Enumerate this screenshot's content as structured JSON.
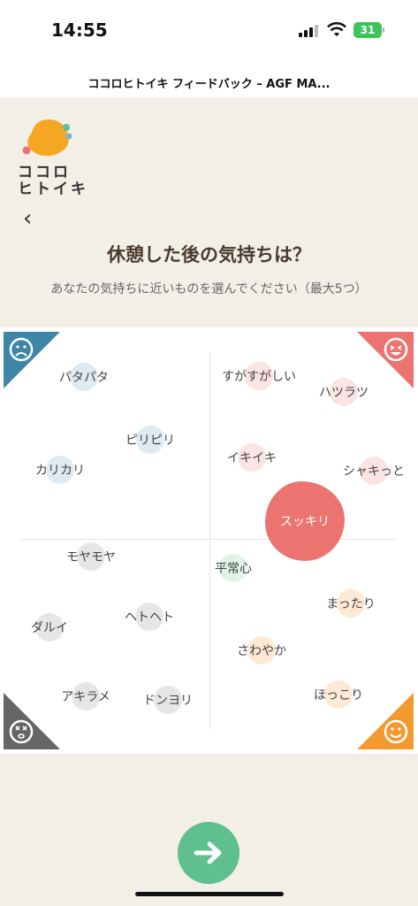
{
  "status_bar": {
    "time": "14:55",
    "battery": "31"
  },
  "page": {
    "title": "ココロヒトイキ フィードバック – AGF MA..."
  },
  "logo": {
    "line1": "ココロ",
    "line2": "ヒトイキ"
  },
  "nav": {
    "back": "‹"
  },
  "question": "休憩した後の気持ちは？",
  "subtitle": "あなたの気持ちに近いものを選んでください（最大5つ）",
  "colors": {
    "blue": "#3e86a8",
    "red": "#ec7470",
    "gray": "#666666",
    "orange": "#f39a2e",
    "green": "#5fbf8e"
  },
  "moods": {
    "patapata": "パタパタ",
    "piripiri": "ピリピリ",
    "karikari": "カリカリ",
    "mojamoja": "モヤモヤ",
    "darui": "ダルイ",
    "hetoheto": "ヘトヘト",
    "akirame": "アキラメ",
    "donyori": "ドンヨリ",
    "sugasugashii": "すがすがしい",
    "haturatu": "ハツラツ",
    "ikiiki": "イキイキ",
    "shakitto": "シャキっと",
    "sukkiri": "スッキリ",
    "heijoushin": "平常心",
    "mattari": "まったり",
    "sawayaka": "さわやか",
    "hokkori": "ほっこり"
  },
  "selected_mood": "スッキリ"
}
